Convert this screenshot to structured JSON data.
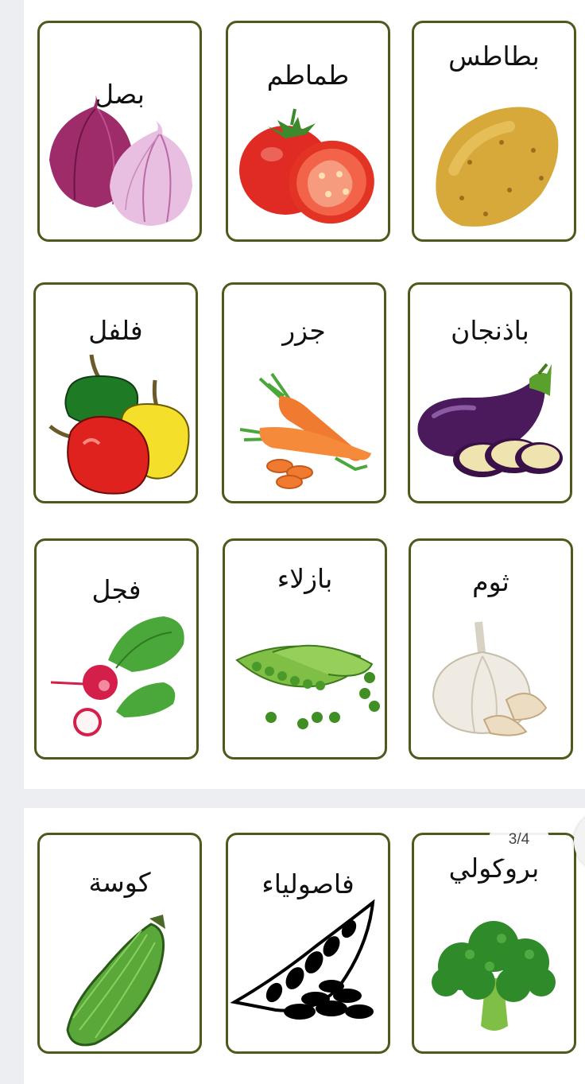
{
  "viewer": {
    "page_counter": "3/4"
  },
  "cards": {
    "onion": "بصل",
    "tomato": "طماطم",
    "potato": "بطاطس",
    "pepper": "فلفل",
    "carrot": "جزر",
    "eggplant": "باذنجان",
    "radish": "فجل",
    "peas": "بازلاء",
    "garlic": "ثوم",
    "zucchini": "كوسة",
    "beans": "فاصولياء",
    "broccoli": "بروكولي"
  },
  "colors": {
    "card_border": "#4d5a1c",
    "page_bg": "#ffffff",
    "viewer_bg": "#eceef1"
  }
}
